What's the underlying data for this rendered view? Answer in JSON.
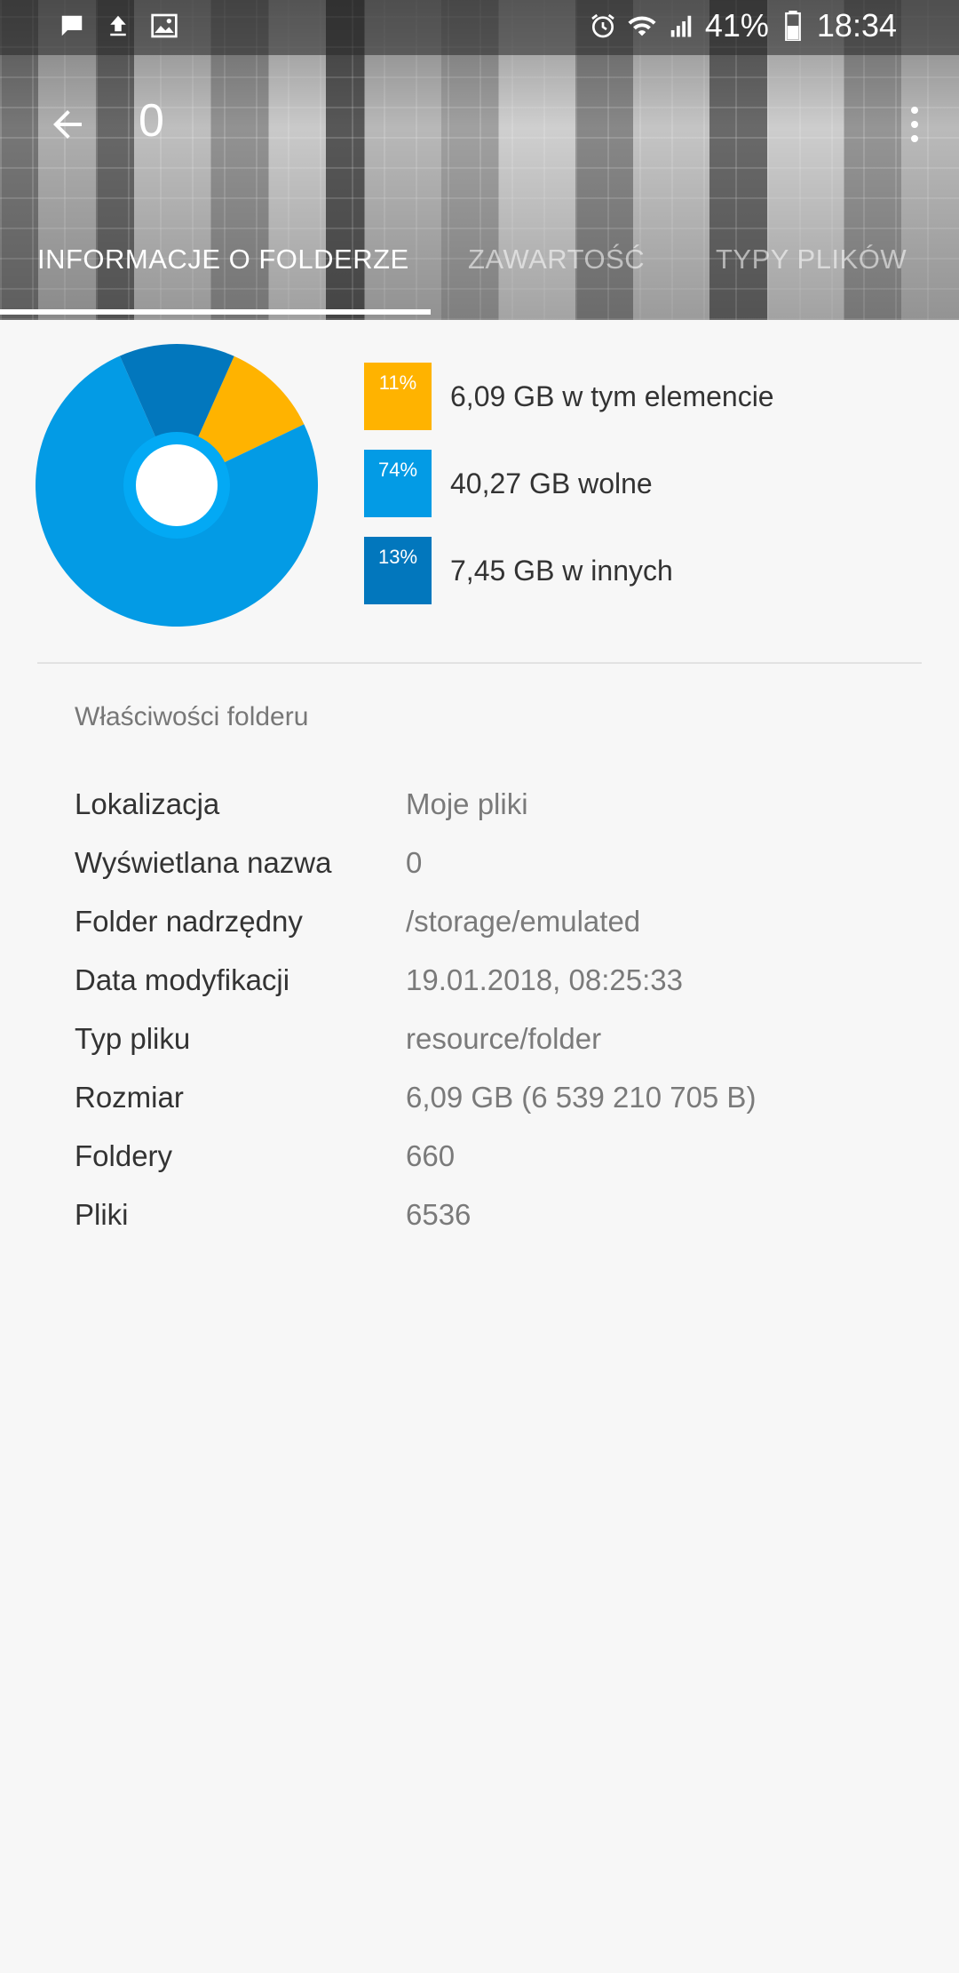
{
  "status_bar": {
    "battery_percent": "41%",
    "time": "18:34",
    "left_icons": [
      "message-icon",
      "upload-icon",
      "image-icon"
    ],
    "right_icons": [
      "alarm-icon",
      "wifi-icon",
      "signal-icon",
      "battery-icon"
    ]
  },
  "toolbar": {
    "title": "0"
  },
  "tabs": [
    {
      "label": "INFORMACJE O FOLDERZE",
      "active": true
    },
    {
      "label": "ZAWARTOŚĆ",
      "active": false
    },
    {
      "label": "TYPY PLIKÓW",
      "active": false
    }
  ],
  "colors": {
    "this_item": "#ffb300",
    "free": "#039be5",
    "others": "#0277bd",
    "pie_inner_ring": "#03a9f4"
  },
  "chart_data": {
    "type": "pie",
    "series": [
      {
        "name": "6,09 GB w tym elemencie",
        "percent_label": "11%",
        "value": 11,
        "color": "#ffb300"
      },
      {
        "name": "40,27 GB wolne",
        "percent_label": "74%",
        "value": 74,
        "color": "#039be5"
      },
      {
        "name": "7,45 GB w innych",
        "percent_label": "13%",
        "value": 13,
        "color": "#0277bd"
      }
    ]
  },
  "properties": {
    "title": "Właściwości folderu",
    "rows": [
      {
        "label": "Lokalizacja",
        "value": "Moje pliki"
      },
      {
        "label": "Wyświetlana nazwa",
        "value": "0"
      },
      {
        "label": "Folder nadrzędny",
        "value": "/storage/emulated"
      },
      {
        "label": "Data modyfikacji",
        "value": "19.01.2018, 08:25:33"
      },
      {
        "label": "Typ pliku",
        "value": "resource/folder"
      },
      {
        "label": "Rozmiar",
        "value": "6,09 GB (6 539 210 705 B)"
      },
      {
        "label": "Foldery",
        "value": "660"
      },
      {
        "label": "Pliki",
        "value": "6536"
      }
    ]
  }
}
